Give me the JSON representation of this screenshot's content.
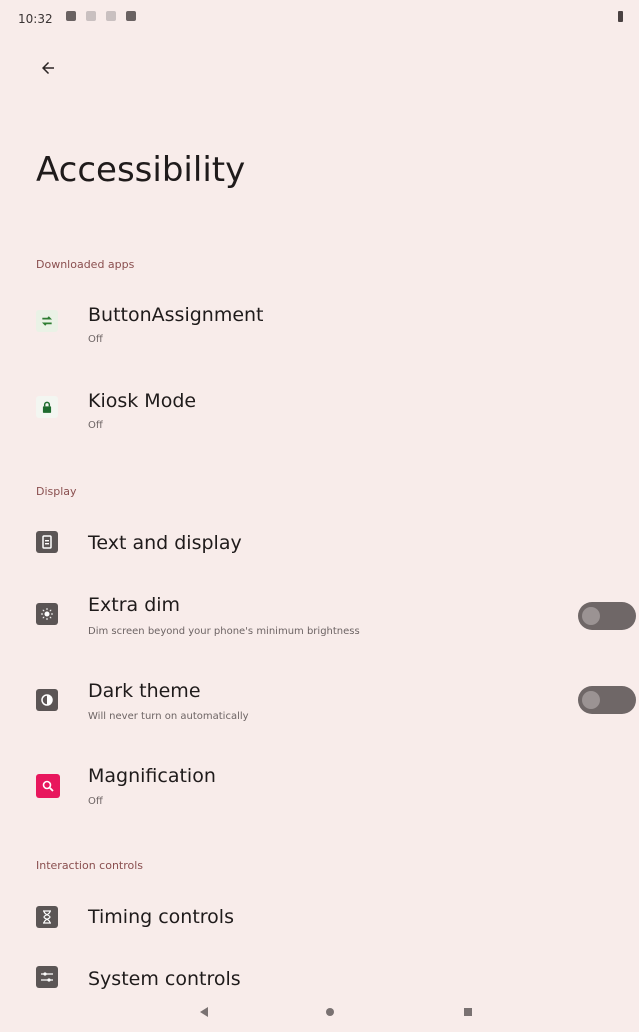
{
  "status_bar": {
    "time": "10:32"
  },
  "header": {
    "title": "Accessibility"
  },
  "sections": {
    "downloaded_apps": {
      "label": "Downloaded apps",
      "items": [
        {
          "title": "ButtonAssignment",
          "summary": "Off",
          "icon": "swap-arrows-icon"
        },
        {
          "title": "Kiosk Mode",
          "summary": "Off",
          "icon": "lock-icon"
        }
      ]
    },
    "display": {
      "label": "Display",
      "items": [
        {
          "title": "Text and display",
          "icon": "text-display-icon"
        },
        {
          "title": "Extra dim",
          "summary": "Dim screen beyond your phone's minimum brightness",
          "icon": "brightness-icon",
          "toggle_on": false
        },
        {
          "title": "Dark theme",
          "summary": "Will never turn on automatically",
          "icon": "contrast-icon",
          "toggle_on": false
        },
        {
          "title": "Magnification",
          "summary": "Off",
          "icon": "magnify-icon"
        }
      ]
    },
    "interaction_controls": {
      "label": "Interaction controls",
      "items": [
        {
          "title": "Timing controls",
          "icon": "hourglass-icon"
        },
        {
          "title": "System controls",
          "icon": "system-controls-icon"
        }
      ]
    }
  },
  "colors": {
    "background": "#F8ECEA",
    "section_header": "#8A4F4F",
    "magnification_icon_bg": "#E8175D",
    "kiosk_icon_color": "#1E6B2E",
    "button_assignment_icon_color": "#2E7D32"
  }
}
